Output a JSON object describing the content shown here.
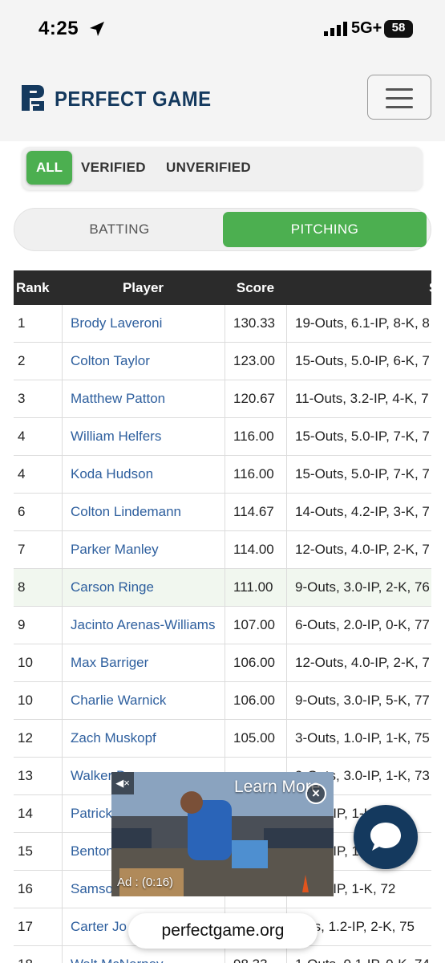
{
  "status": {
    "time": "4:25",
    "network": "5G+",
    "battery": "58"
  },
  "header": {
    "brand": "PERFECT GAME"
  },
  "filters": {
    "all": "ALL",
    "verified": "VERIFIED",
    "unverified": "UNVERIFIED",
    "active": "ALL"
  },
  "segments": {
    "batting": "BATTING",
    "pitching": "PITCHING",
    "active": "PITCHING"
  },
  "table": {
    "headers": {
      "rank": "Rank",
      "player": "Player",
      "score": "Score",
      "stats": "S"
    },
    "rows": [
      {
        "rank": "1",
        "player": "Brody Laveroni",
        "score": "130.33",
        "stats": "19-Outs, 6.1-IP, 8-K, 8"
      },
      {
        "rank": "2",
        "player": "Colton Taylor",
        "score": "123.00",
        "stats": "15-Outs, 5.0-IP, 6-K, 7"
      },
      {
        "rank": "3",
        "player": "Matthew Patton",
        "score": "120.67",
        "stats": "11-Outs, 3.2-IP, 4-K, 7"
      },
      {
        "rank": "4",
        "player": "William Helfers",
        "score": "116.00",
        "stats": "15-Outs, 5.0-IP, 7-K, 7"
      },
      {
        "rank": "4",
        "player": "Koda Hudson",
        "score": "116.00",
        "stats": "15-Outs, 5.0-IP, 7-K, 7"
      },
      {
        "rank": "6",
        "player": "Colton Lindemann",
        "score": "114.67",
        "stats": "14-Outs, 4.2-IP, 3-K, 7"
      },
      {
        "rank": "7",
        "player": "Parker Manley",
        "score": "114.00",
        "stats": "12-Outs, 4.0-IP, 2-K, 7"
      },
      {
        "rank": "8",
        "player": "Carson Ringe",
        "score": "111.00",
        "stats": "9-Outs, 3.0-IP, 2-K, 76"
      },
      {
        "rank": "9",
        "player": "Jacinto Arenas-Williams",
        "score": "107.00",
        "stats": "6-Outs, 2.0-IP, 0-K, 77"
      },
      {
        "rank": "10",
        "player": "Max Barriger",
        "score": "106.00",
        "stats": "12-Outs, 4.0-IP, 2-K, 7"
      },
      {
        "rank": "10",
        "player": "Charlie Warnick",
        "score": "106.00",
        "stats": "9-Outs, 3.0-IP, 5-K, 77"
      },
      {
        "rank": "12",
        "player": "Zach Muskopf",
        "score": "105.00",
        "stats": "3-Outs, 1.0-IP, 1-K, 75"
      },
      {
        "rank": "13",
        "player": "Walker D",
        "score": "",
        "stats": "9-Outs, 3.0-IP, 1-K, 73"
      },
      {
        "rank": "14",
        "player": "Patrick",
        "score": "",
        "stats": "s, 1.0-IP, 1-K, 76"
      },
      {
        "rank": "15",
        "player": "Benton",
        "score": "",
        "stats": "s, 3.0-IP, 1-K, 81"
      },
      {
        "rank": "16",
        "player": "Samso",
        "score": "",
        "stats": "s, 0.1-IP, 1-K, 72"
      },
      {
        "rank": "17",
        "player": "Carter Jo",
        "score": "",
        "stats": "outs, 1.2-IP, 2-K, 75"
      },
      {
        "rank": "18",
        "player": "Walt McNerney",
        "score": "98.33",
        "stats": "1-Outs, 0.1-IP, 0-K, 74"
      }
    ],
    "highlight_row": 8
  },
  "ad": {
    "learn_more": "Learn More",
    "timer": "Ad : (0:16)",
    "close": "×",
    "mute": "◀×"
  },
  "browser": {
    "url": "perfectgame.org"
  },
  "colors": {
    "green": "#4caf50",
    "navy": "#14395e",
    "link": "#2e5f9e",
    "header_bg": "#2b2b2b"
  }
}
